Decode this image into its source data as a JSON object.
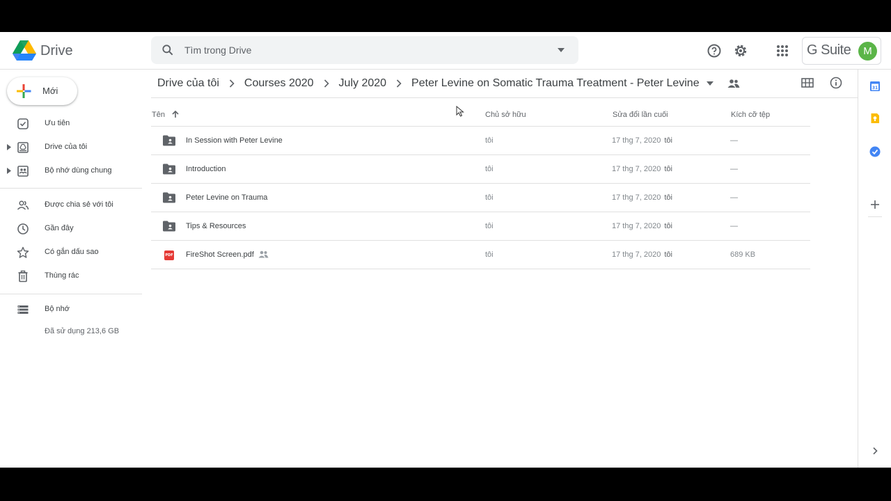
{
  "app": {
    "name": "Drive"
  },
  "search": {
    "placeholder": "Tìm trong Drive"
  },
  "account": {
    "suite_label": "G Suite",
    "avatar_letter": "M",
    "avatar_color": "#5bb548"
  },
  "sidebar": {
    "new_label": "Mới",
    "items": [
      {
        "label": "Ưu tiên",
        "icon": "priority-icon"
      },
      {
        "label": "Drive của tôi",
        "icon": "my-drive-icon"
      },
      {
        "label": "Bộ nhớ dùng chung",
        "icon": "shared-drives-icon"
      },
      {
        "label": "Được chia sẻ với tôi",
        "icon": "shared-with-me-icon"
      },
      {
        "label": "Gần đây",
        "icon": "recent-icon"
      },
      {
        "label": "Có gắn dấu sao",
        "icon": "star-icon"
      },
      {
        "label": "Thùng rác",
        "icon": "trash-icon"
      },
      {
        "label": "Bộ nhớ",
        "icon": "storage-icon"
      }
    ],
    "storage_used": "Đã sử dụng 213,6 GB"
  },
  "breadcrumb": [
    "Drive của tôi",
    "Courses 2020",
    "July 2020",
    "Peter Levine on Somatic Trauma Treatment - Peter Levine"
  ],
  "table": {
    "columns": {
      "name": "Tên",
      "owner": "Chủ sở hữu",
      "modified": "Sửa đổi lần cuối",
      "size": "Kích cỡ tệp"
    },
    "rows": [
      {
        "type": "shared-folder",
        "name": "In Session with Peter Levine",
        "owner": "tôi",
        "modified": "17 thg 7, 2020",
        "modified_by": "tôi",
        "size": "—"
      },
      {
        "type": "shared-folder",
        "name": "Introduction",
        "owner": "tôi",
        "modified": "17 thg 7, 2020",
        "modified_by": "tôi",
        "size": "—"
      },
      {
        "type": "shared-folder",
        "name": "Peter Levine on Trauma",
        "owner": "tôi",
        "modified": "17 thg 7, 2020",
        "modified_by": "tôi",
        "size": "—"
      },
      {
        "type": "shared-folder",
        "name": "Tips & Resources",
        "owner": "tôi",
        "modified": "17 thg 7, 2020",
        "modified_by": "tôi",
        "size": "—"
      },
      {
        "type": "pdf",
        "name": "FireShot Screen.pdf",
        "shared": true,
        "owner": "tôi",
        "modified": "17 thg 7, 2020",
        "modified_by": "tôi",
        "size": "689 KB",
        "badge": "PDF"
      }
    ]
  }
}
